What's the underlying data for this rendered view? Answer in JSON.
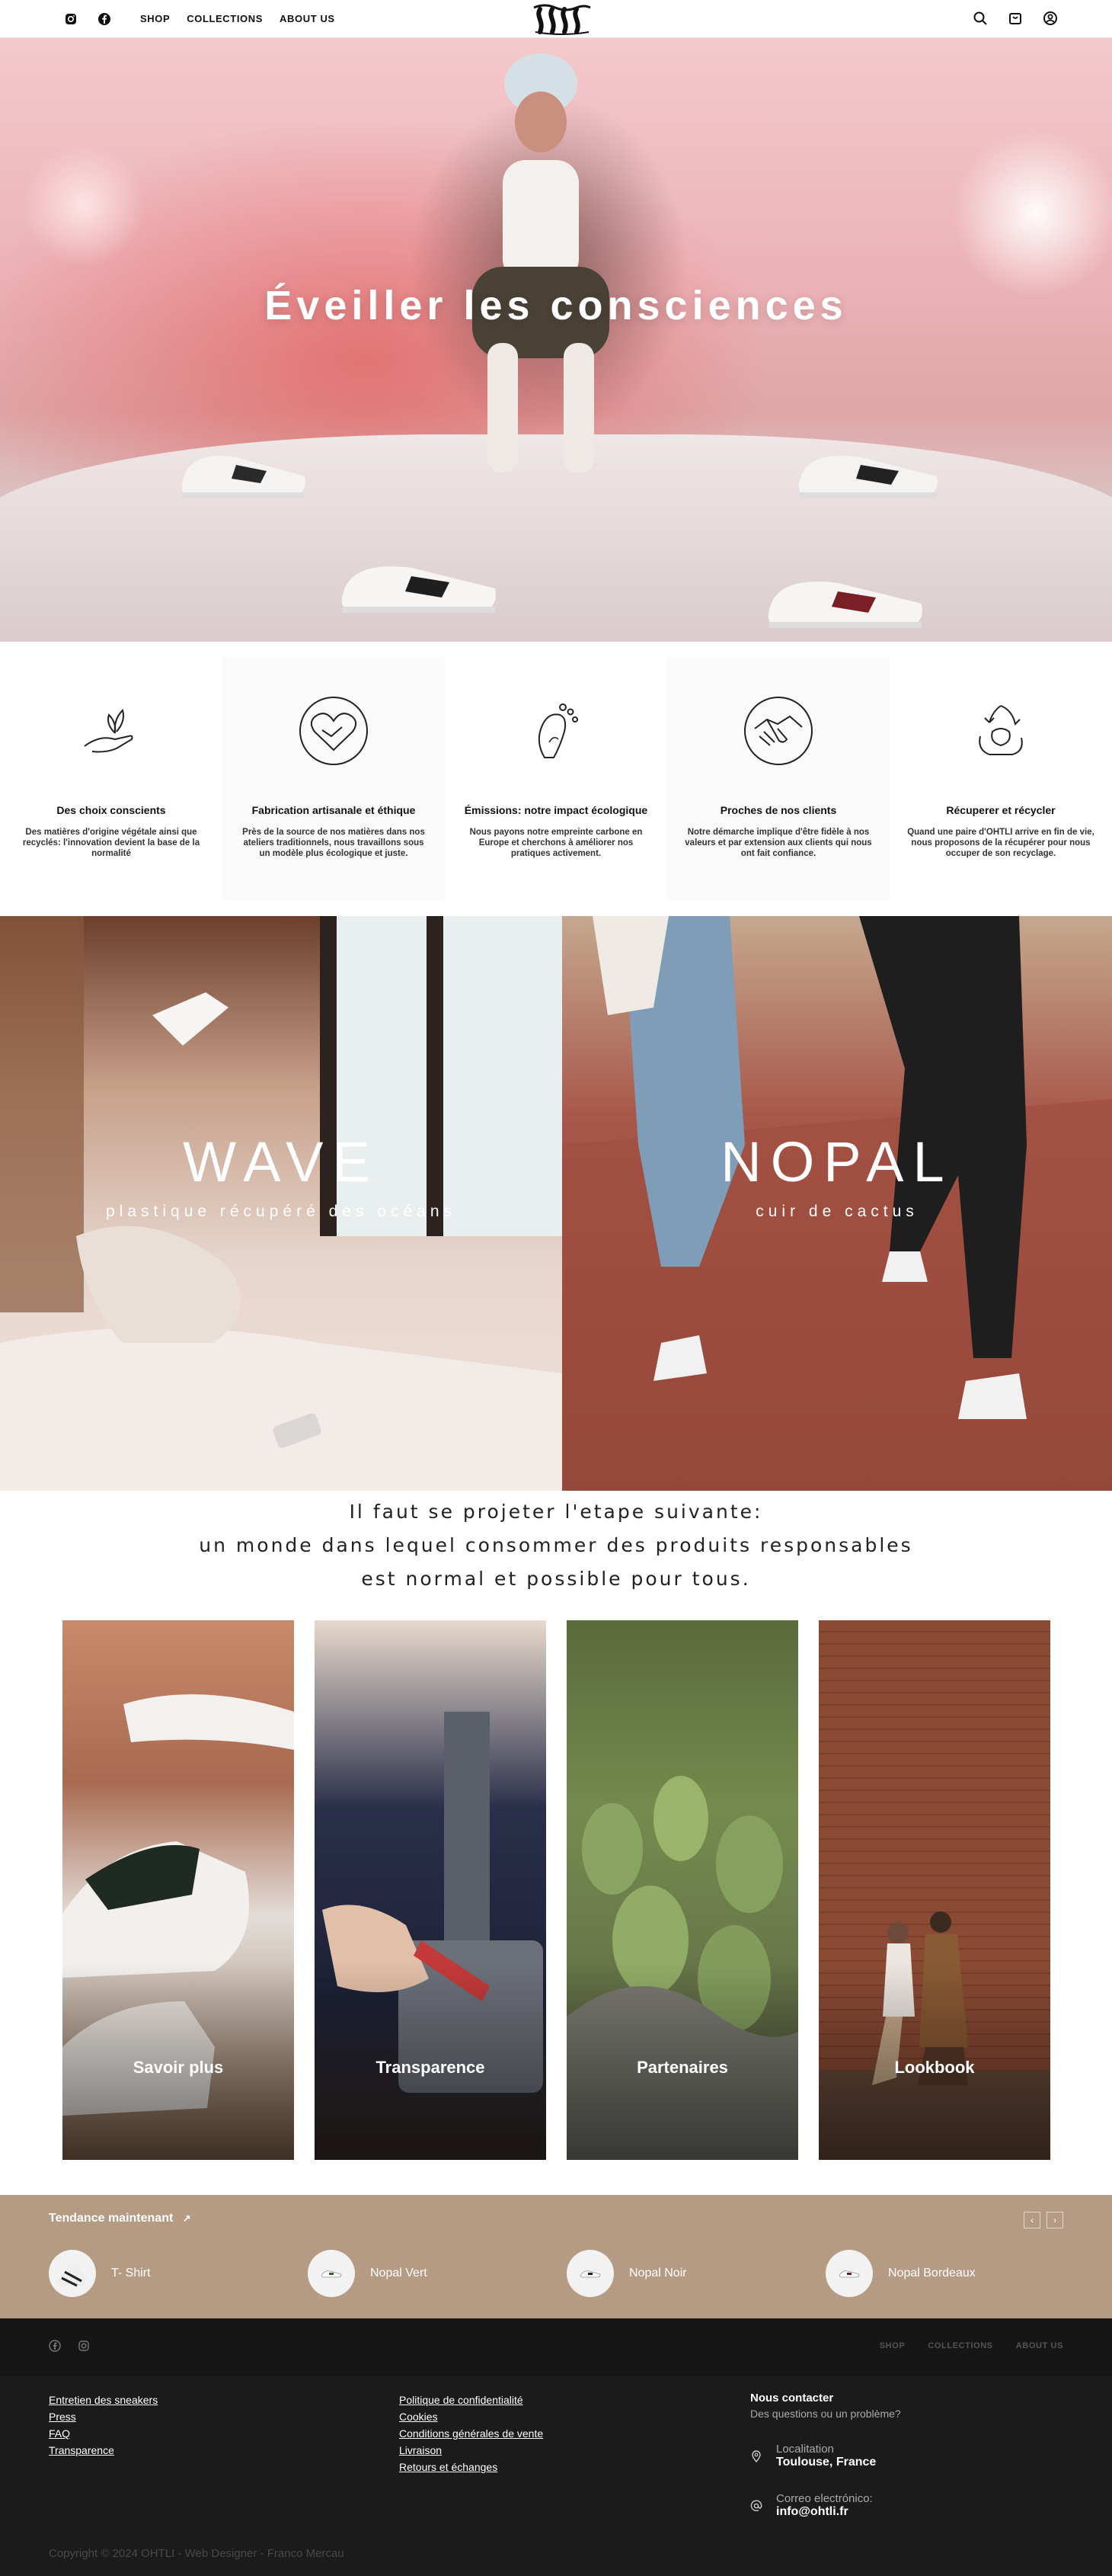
{
  "header": {
    "social_icons": [
      "instagram-icon",
      "facebook-icon"
    ],
    "nav": [
      "SHOP",
      "COLLECTIONS",
      "ABOUT US"
    ],
    "right_icons": [
      "search-icon",
      "cart-icon",
      "account-icon"
    ]
  },
  "hero": {
    "title": "Éveiller les consciences"
  },
  "values": [
    {
      "title": "Des choix conscients",
      "text": "Des matières d'origine végétale ainsi que recyclés: l'innovation devient la base de la normalité",
      "icon": "hand-plant-icon"
    },
    {
      "title": "Fabrication artisanale et éthique",
      "text": "Près de la source de nos matières dans nos ateliers traditionnels, nous travaillons sous un modèle plus écologique et juste.",
      "icon": "heart-handshake-icon"
    },
    {
      "title": "Émissions: notre impact écologique",
      "text": "Nous payons notre empreinte carbone en Europe et cherchons à améliorer nos pratiques activement.",
      "icon": "footprint-icon"
    },
    {
      "title": "Proches de nos clients",
      "text": "Notre démarche implique d'être fidèle à nos valeurs et par extension aux clients qui nous ont fait confiance.",
      "icon": "handshake-icon"
    },
    {
      "title": "Récuperer et récycler",
      "text": "Quand une paire d'OHTLI arrive en fin de vie, nous proposons de la récupérer pour nous occuper de son recyclage.",
      "icon": "recycle-icon"
    }
  ],
  "collections": [
    {
      "title": "WAVE",
      "subtitle": "plastique récupéré des océans"
    },
    {
      "title": "NOPAL",
      "subtitle": "cuir de cactus"
    }
  ],
  "tagline": [
    "Il faut se projeter l'etape suivante:",
    "un monde dans lequel consommer des produits responsables",
    "est normal et possible pour tous."
  ],
  "cards": [
    "Savoir plus",
    "Transparence",
    "Partenaires",
    "Lookbook"
  ],
  "trending": {
    "heading": "Tendance maintenant",
    "arrows": [
      "‹",
      "›"
    ],
    "items": [
      "T- Shirt",
      "Nopal Vert",
      "Nopal Noir",
      "Nopal Bordeaux"
    ]
  },
  "footer": {
    "nav": [
      "SHOP",
      "COLLECTIONS",
      "ABOUT US"
    ],
    "links_left": [
      "Entretien des sneakers",
      "Press",
      "FAQ",
      "Transparence"
    ],
    "links_mid": [
      "Politique de confidentialité",
      "Cookies",
      "Conditions générales de vente",
      "Livraison",
      "Retours et échanges"
    ],
    "contact": {
      "heading": "Nous contacter",
      "question": "Des questions ou un problème?",
      "location_label": "Localitation",
      "location_value": "Toulouse, France",
      "email_label": "Correo electrónico:",
      "email_value": "info@ohtli.fr"
    },
    "copyright": "Copyright © 2024 OHTLI - Web Designer - Franco Mercau"
  },
  "colors": {
    "trending_bg": "#b59a84",
    "footer_bg": "#1b1b1b",
    "hero_tint": "#ecb2b6"
  }
}
